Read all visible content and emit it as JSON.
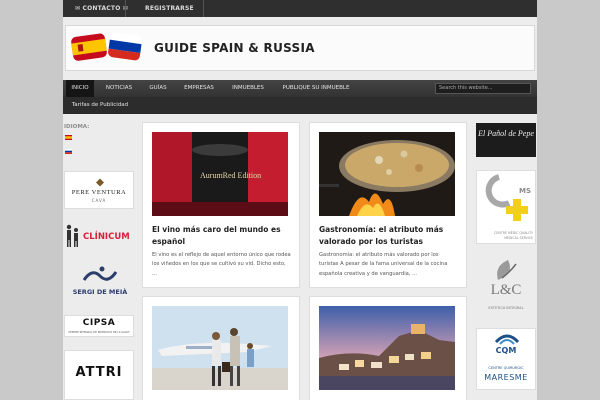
{
  "topbar": {
    "contacto": "✉ CONTACTO ✉",
    "registrarse": "REGISTRARSE"
  },
  "header": {
    "title": "GUIDE SPAIN & RUSSIA"
  },
  "nav": {
    "items": [
      "INICIO",
      "NOTICIAS",
      "GUÍAS",
      "EMPRESAS",
      "INMUEBLES",
      "PUBLIQUE SU INMUEBLE"
    ],
    "active_index": 0,
    "row2_item": "Tarifas de Publicidad",
    "search_placeholder": "Search this website..."
  },
  "sidebar_left": {
    "idioma_label": "IDIOMA:",
    "languages": [
      "Español",
      "Русский"
    ],
    "ads": [
      {
        "line1": "PERE VENTURA",
        "line2": "CAVA"
      },
      {
        "line1": "CLÍNICUM"
      },
      {
        "line1": "SERGI DE MEIÀ"
      },
      {
        "line1": "CIPSA",
        "line2": "CENTRE INTEGRAL DE PROMOCIÓ DE LA SALUT"
      },
      {
        "line1": "ATTRI"
      }
    ]
  },
  "sidebar_right": {
    "ads": [
      {
        "line1": "El Pañol de Pepe"
      },
      {
        "line1": "MS",
        "line2": "CENTRE MÈDIC QUALITY MEDICAL SERVICE"
      },
      {
        "line1": "L&C",
        "line2": "ESTETICA INTEGRAL"
      },
      {
        "line1": "CQM",
        "line2": "CENTRE QUIRÚRGIC",
        "line3": "MARESME"
      }
    ]
  },
  "posts": [
    {
      "title": "El vino más caro del mundo es español",
      "excerpt": "El vino es el reflejo de aquel entorno único que rodea los viñedos en los que se cultivó su vid. Dicho esto, ...",
      "image_label": "AurumRed Edition"
    },
    {
      "title": "Gastronomía: el atributo más valorado por los turistas",
      "excerpt": "Gastronomía: el atributo más valorado por los turistas A pesar de la fama universal de la cocina española creativa y de vanguardia, ..."
    },
    {
      "title": "",
      "excerpt": ""
    },
    {
      "title": "",
      "excerpt": ""
    }
  ],
  "colors": {
    "topbar": "#2f2f2f",
    "nav": "#3a3a3a",
    "page_bg": "#ececec",
    "outer_bg": "#c9c9c9",
    "clinicum_red": "#d6213b",
    "ms_yellow": "#f2d01a",
    "cqm_blue": "#1e4f86"
  }
}
